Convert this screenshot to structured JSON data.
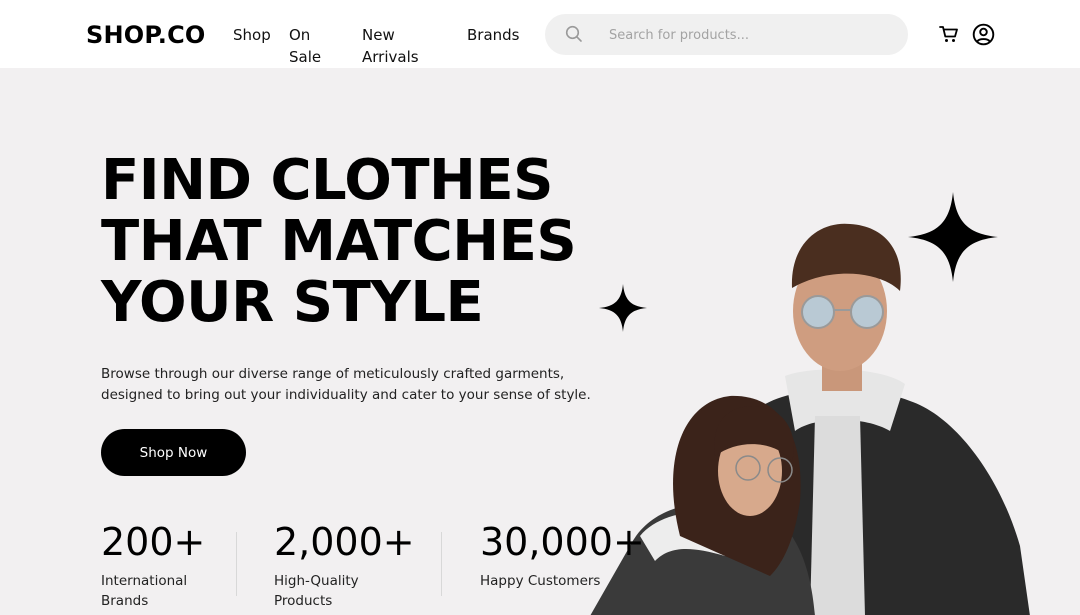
{
  "header": {
    "logo": "SHOP.CO",
    "nav": [
      {
        "label": "Shop"
      },
      {
        "label": "On Sale"
      },
      {
        "label": "New Arrivals"
      },
      {
        "label": "Brands"
      }
    ],
    "search": {
      "placeholder": "Search for products...",
      "value": "",
      "icon": "search-icon"
    },
    "icons": [
      "cart-icon",
      "account-icon"
    ]
  },
  "hero": {
    "headline_lines": [
      "FIND CLOTHES",
      "THAT MATCHES",
      "YOUR STYLE"
    ],
    "subtext": "Browse through our diverse range of meticulously crafted garments, designed to bring out your individuality and cater to your sense of style.",
    "cta_label": "Shop Now",
    "stats": [
      {
        "value": "200+",
        "label": "International Brands"
      },
      {
        "value": "2,000+",
        "label": "High-Quality Products"
      },
      {
        "value": "30,000+",
        "label": "Happy Customers"
      }
    ]
  },
  "colors": {
    "hero_background": "#f2f0f1",
    "primary": "#000000",
    "search_background": "#f0f0f0"
  }
}
